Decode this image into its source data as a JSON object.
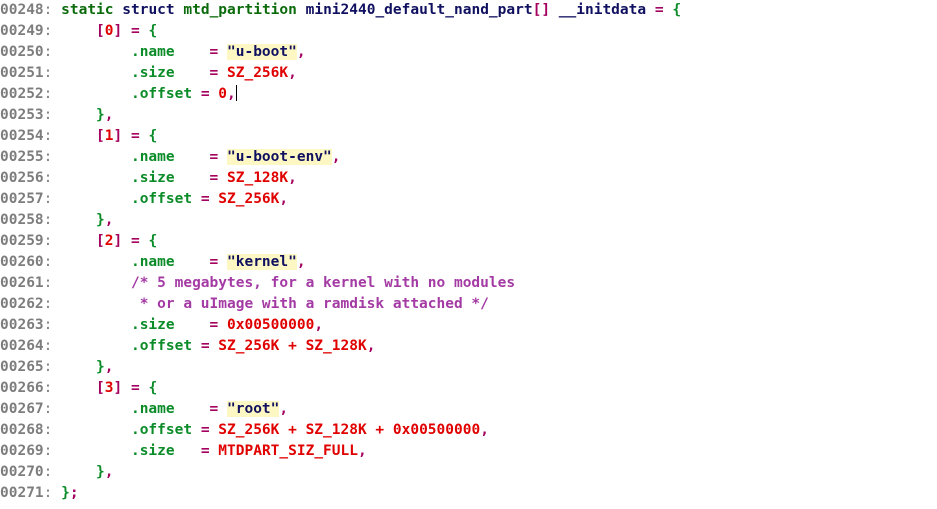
{
  "viewer": {
    "name": "source-code-viewer",
    "language": "c",
    "background_color": "#ffffff",
    "font_family_kind": "monospace",
    "first_line_number": "00248",
    "last_line_number": "00271",
    "visible_line_count": 24,
    "caret": {
      "line_number": "00252",
      "after_text": "0,"
    }
  },
  "palette": {
    "line_number": "#7d7d7d",
    "keyword_green": "#0b6b0b",
    "keyword_navy": "#101060",
    "member": "#0b8c28",
    "operator": "#a3005f",
    "number": "#e00000",
    "brace": "#0b8c28",
    "string_text": "#101060",
    "string_highlight_bg": "#fdf7c3",
    "comment": "#a43aa4"
  },
  "lines": [
    {
      "number": "00248",
      "text": "static struct mtd_partition mini2440_default_nand_part[] __initdata = {",
      "tokens": [
        {
          "t": "static",
          "c": "kw"
        },
        {
          "t": " ",
          "c": "plain"
        },
        {
          "t": "struct",
          "c": "kw2"
        },
        {
          "t": " ",
          "c": "plain"
        },
        {
          "t": "mtd_partition",
          "c": "type"
        },
        {
          "t": " ",
          "c": "plain"
        },
        {
          "t": "mini2440_default_nand_part",
          "c": "ident"
        },
        {
          "t": "[]",
          "c": "op"
        },
        {
          "t": " ",
          "c": "plain"
        },
        {
          "t": "__initdata",
          "c": "ident"
        },
        {
          "t": " ",
          "c": "plain"
        },
        {
          "t": "=",
          "c": "op"
        },
        {
          "t": " ",
          "c": "plain"
        },
        {
          "t": "{",
          "c": "brace"
        }
      ]
    },
    {
      "number": "00249",
      "text": "    [0] = {",
      "tokens": [
        {
          "t": "    ",
          "c": "plain"
        },
        {
          "t": "[",
          "c": "op"
        },
        {
          "t": "0",
          "c": "num"
        },
        {
          "t": "]",
          "c": "op"
        },
        {
          "t": " ",
          "c": "plain"
        },
        {
          "t": "=",
          "c": "op"
        },
        {
          "t": " ",
          "c": "plain"
        },
        {
          "t": "{",
          "c": "brace"
        }
      ]
    },
    {
      "number": "00250",
      "text": "        .name    = \"u-boot\",",
      "tokens": [
        {
          "t": "        ",
          "c": "plain"
        },
        {
          "t": ".name",
          "c": "member"
        },
        {
          "t": "    ",
          "c": "plain"
        },
        {
          "t": "=",
          "c": "op"
        },
        {
          "t": " ",
          "c": "plain"
        },
        {
          "t": "\"u-boot\"",
          "c": "str"
        },
        {
          "t": ",",
          "c": "op"
        }
      ]
    },
    {
      "number": "00251",
      "text": "        .size    = SZ_256K,",
      "tokens": [
        {
          "t": "        ",
          "c": "plain"
        },
        {
          "t": ".size",
          "c": "member"
        },
        {
          "t": "    ",
          "c": "plain"
        },
        {
          "t": "=",
          "c": "op"
        },
        {
          "t": " ",
          "c": "plain"
        },
        {
          "t": "SZ_256K",
          "c": "num"
        },
        {
          "t": ",",
          "c": "op"
        }
      ]
    },
    {
      "number": "00252",
      "text": "        .offset = 0,",
      "caret_after": true,
      "tokens": [
        {
          "t": "        ",
          "c": "plain"
        },
        {
          "t": ".offset",
          "c": "member"
        },
        {
          "t": " ",
          "c": "plain"
        },
        {
          "t": "=",
          "c": "op"
        },
        {
          "t": " ",
          "c": "plain"
        },
        {
          "t": "0",
          "c": "num"
        },
        {
          "t": ",",
          "c": "op"
        }
      ]
    },
    {
      "number": "00253",
      "text": "    },",
      "tokens": [
        {
          "t": "    ",
          "c": "plain"
        },
        {
          "t": "}",
          "c": "brace"
        },
        {
          "t": ",",
          "c": "op"
        }
      ]
    },
    {
      "number": "00254",
      "text": "    [1] = {",
      "tokens": [
        {
          "t": "    ",
          "c": "plain"
        },
        {
          "t": "[",
          "c": "op"
        },
        {
          "t": "1",
          "c": "num"
        },
        {
          "t": "]",
          "c": "op"
        },
        {
          "t": " ",
          "c": "plain"
        },
        {
          "t": "=",
          "c": "op"
        },
        {
          "t": " ",
          "c": "plain"
        },
        {
          "t": "{",
          "c": "brace"
        }
      ]
    },
    {
      "number": "00255",
      "text": "        .name    = \"u-boot-env\",",
      "tokens": [
        {
          "t": "        ",
          "c": "plain"
        },
        {
          "t": ".name",
          "c": "member"
        },
        {
          "t": "    ",
          "c": "plain"
        },
        {
          "t": "=",
          "c": "op"
        },
        {
          "t": " ",
          "c": "plain"
        },
        {
          "t": "\"u-boot-env\"",
          "c": "str"
        },
        {
          "t": ",",
          "c": "op"
        }
      ]
    },
    {
      "number": "00256",
      "text": "        .size    = SZ_128K,",
      "tokens": [
        {
          "t": "        ",
          "c": "plain"
        },
        {
          "t": ".size",
          "c": "member"
        },
        {
          "t": "    ",
          "c": "plain"
        },
        {
          "t": "=",
          "c": "op"
        },
        {
          "t": " ",
          "c": "plain"
        },
        {
          "t": "SZ_128K",
          "c": "num"
        },
        {
          "t": ",",
          "c": "op"
        }
      ]
    },
    {
      "number": "00257",
      "text": "        .offset = SZ_256K,",
      "tokens": [
        {
          "t": "        ",
          "c": "plain"
        },
        {
          "t": ".offset",
          "c": "member"
        },
        {
          "t": " ",
          "c": "plain"
        },
        {
          "t": "=",
          "c": "op"
        },
        {
          "t": " ",
          "c": "plain"
        },
        {
          "t": "SZ_256K",
          "c": "num"
        },
        {
          "t": ",",
          "c": "op"
        }
      ]
    },
    {
      "number": "00258",
      "text": "    },",
      "tokens": [
        {
          "t": "    ",
          "c": "plain"
        },
        {
          "t": "}",
          "c": "brace"
        },
        {
          "t": ",",
          "c": "op"
        }
      ]
    },
    {
      "number": "00259",
      "text": "    [2] = {",
      "tokens": [
        {
          "t": "    ",
          "c": "plain"
        },
        {
          "t": "[",
          "c": "op"
        },
        {
          "t": "2",
          "c": "num"
        },
        {
          "t": "]",
          "c": "op"
        },
        {
          "t": " ",
          "c": "plain"
        },
        {
          "t": "=",
          "c": "op"
        },
        {
          "t": " ",
          "c": "plain"
        },
        {
          "t": "{",
          "c": "brace"
        }
      ]
    },
    {
      "number": "00260",
      "text": "        .name    = \"kernel\",",
      "tokens": [
        {
          "t": "        ",
          "c": "plain"
        },
        {
          "t": ".name",
          "c": "member"
        },
        {
          "t": "    ",
          "c": "plain"
        },
        {
          "t": "=",
          "c": "op"
        },
        {
          "t": " ",
          "c": "plain"
        },
        {
          "t": "\"kernel\"",
          "c": "str"
        },
        {
          "t": ",",
          "c": "op"
        }
      ]
    },
    {
      "number": "00261",
      "text": "        /* 5 megabytes, for a kernel with no modules",
      "tokens": [
        {
          "t": "        ",
          "c": "plain"
        },
        {
          "t": "/* 5 megabytes, for a kernel with no modules",
          "c": "cmt"
        }
      ]
    },
    {
      "number": "00262",
      "text": "         * or a uImage with a ramdisk attached */",
      "tokens": [
        {
          "t": "         ",
          "c": "plain"
        },
        {
          "t": "* or a uImage with a ramdisk attached */",
          "c": "cmt"
        }
      ]
    },
    {
      "number": "00263",
      "text": "        .size    = 0x00500000,",
      "tokens": [
        {
          "t": "        ",
          "c": "plain"
        },
        {
          "t": ".size",
          "c": "member"
        },
        {
          "t": "    ",
          "c": "plain"
        },
        {
          "t": "=",
          "c": "op"
        },
        {
          "t": " ",
          "c": "plain"
        },
        {
          "t": "0x00500000",
          "c": "num"
        },
        {
          "t": ",",
          "c": "op"
        }
      ]
    },
    {
      "number": "00264",
      "text": "        .offset = SZ_256K + SZ_128K,",
      "tokens": [
        {
          "t": "        ",
          "c": "plain"
        },
        {
          "t": ".offset",
          "c": "member"
        },
        {
          "t": " ",
          "c": "plain"
        },
        {
          "t": "=",
          "c": "op"
        },
        {
          "t": " ",
          "c": "plain"
        },
        {
          "t": "SZ_256K + SZ_128K",
          "c": "num"
        },
        {
          "t": ",",
          "c": "op"
        }
      ]
    },
    {
      "number": "00265",
      "text": "    },",
      "tokens": [
        {
          "t": "    ",
          "c": "plain"
        },
        {
          "t": "}",
          "c": "brace"
        },
        {
          "t": ",",
          "c": "op"
        }
      ]
    },
    {
      "number": "00266",
      "text": "    [3] = {",
      "tokens": [
        {
          "t": "    ",
          "c": "plain"
        },
        {
          "t": "[",
          "c": "op"
        },
        {
          "t": "3",
          "c": "num"
        },
        {
          "t": "]",
          "c": "op"
        },
        {
          "t": " ",
          "c": "plain"
        },
        {
          "t": "=",
          "c": "op"
        },
        {
          "t": " ",
          "c": "plain"
        },
        {
          "t": "{",
          "c": "brace"
        }
      ]
    },
    {
      "number": "00267",
      "text": "        .name    = \"root\",",
      "tokens": [
        {
          "t": "        ",
          "c": "plain"
        },
        {
          "t": ".name",
          "c": "member"
        },
        {
          "t": "    ",
          "c": "plain"
        },
        {
          "t": "=",
          "c": "op"
        },
        {
          "t": " ",
          "c": "plain"
        },
        {
          "t": "\"root\"",
          "c": "str"
        },
        {
          "t": ",",
          "c": "op"
        }
      ]
    },
    {
      "number": "00268",
      "text": "        .offset = SZ_256K + SZ_128K + 0x00500000,",
      "tokens": [
        {
          "t": "        ",
          "c": "plain"
        },
        {
          "t": ".offset",
          "c": "member"
        },
        {
          "t": " ",
          "c": "plain"
        },
        {
          "t": "=",
          "c": "op"
        },
        {
          "t": " ",
          "c": "plain"
        },
        {
          "t": "SZ_256K + SZ_128K + 0x00500000",
          "c": "num"
        },
        {
          "t": ",",
          "c": "op"
        }
      ]
    },
    {
      "number": "00269",
      "text": "        .size   = MTDPART_SIZ_FULL,",
      "tokens": [
        {
          "t": "        ",
          "c": "plain"
        },
        {
          "t": ".size",
          "c": "member"
        },
        {
          "t": "   ",
          "c": "plain"
        },
        {
          "t": "=",
          "c": "op"
        },
        {
          "t": " ",
          "c": "plain"
        },
        {
          "t": "MTDPART_SIZ_FULL",
          "c": "num"
        },
        {
          "t": ",",
          "c": "op"
        }
      ]
    },
    {
      "number": "00270",
      "text": "    },",
      "tokens": [
        {
          "t": "    ",
          "c": "plain"
        },
        {
          "t": "}",
          "c": "brace"
        },
        {
          "t": ",",
          "c": "op"
        }
      ]
    },
    {
      "number": "00271",
      "text": "};",
      "tokens": [
        {
          "t": "}",
          "c": "brace"
        },
        {
          "t": ";",
          "c": "op"
        }
      ]
    }
  ]
}
